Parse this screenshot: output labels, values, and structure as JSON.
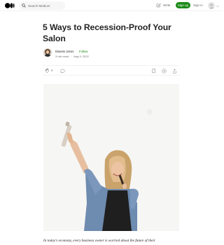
{
  "topbar": {
    "search_placeholder": "Search Medium",
    "write_label": "Write",
    "signup_label": "Sign up",
    "signin_label": "Sign in"
  },
  "article": {
    "title": "5 Ways to Recession-Proof Your Salon",
    "author": "Dawnis Jarvis",
    "follow_label": "Follow",
    "read_time": "3 min read",
    "date": "Aug 9, 2022",
    "claps": "4",
    "intro": "In today's economy, every business owner is worried about the future of their"
  },
  "colors": {
    "accent_green": "#1a8917",
    "text": "#242424",
    "muted": "#6b6b6b"
  },
  "icons": [
    "medium-logo-icon",
    "search-icon",
    "write-icon",
    "avatar-icon",
    "chevron-down-icon",
    "clap-icon",
    "comment-icon",
    "bookmark-icon",
    "play-icon",
    "share-icon"
  ]
}
